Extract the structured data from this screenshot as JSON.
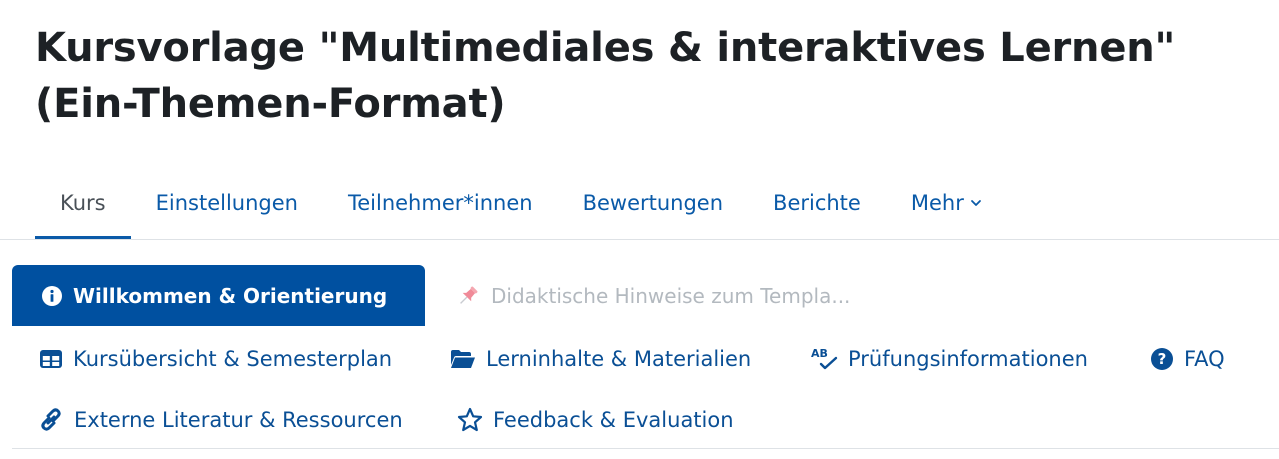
{
  "page": {
    "title": "Kursvorlage \"Multimediales & interaktives Lernen\" (Ein-Themen-Format)"
  },
  "nav": {
    "items": [
      {
        "label": "Kurs",
        "active": true
      },
      {
        "label": "Einstellungen"
      },
      {
        "label": "Teilnehmer*innen"
      },
      {
        "label": "Bewertungen"
      },
      {
        "label": "Berichte"
      },
      {
        "label": "Mehr",
        "icon": "chevron-down-icon"
      }
    ]
  },
  "tabs": {
    "active": {
      "label": "Willkommen & Orientierung",
      "icon": "info-circle-icon"
    },
    "disabled": {
      "label": "Didaktische Hinweise zum Templa...",
      "icon": "pushpin-icon"
    }
  },
  "links": {
    "row1": [
      {
        "label": "Kursübersicht & Semesterplan",
        "icon": "table-icon"
      },
      {
        "label": "Lerninhalte & Materialien",
        "icon": "folder-open-icon"
      },
      {
        "label": "Prüfungsinformationen",
        "icon": "spellcheck-icon"
      },
      {
        "label": "FAQ",
        "icon": "question-circle-icon"
      }
    ],
    "row2": [
      {
        "label": "Externe Literatur & Ressourcen",
        "icon": "link-icon"
      },
      {
        "label": "Feedback & Evaluation",
        "icon": "star-icon"
      }
    ]
  },
  "colors": {
    "brand_blue": "#0050a0",
    "link_blue": "#0a4f95",
    "disabled_gray": "#b3b9bf"
  }
}
